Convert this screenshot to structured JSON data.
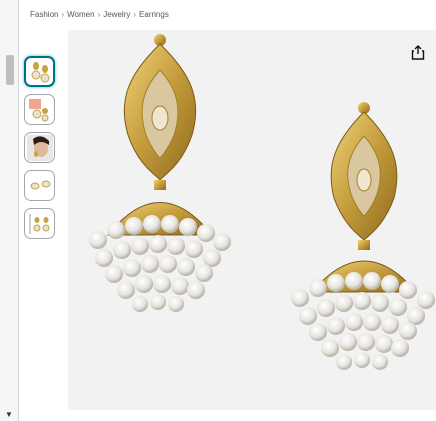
{
  "breadcrumb": [
    "Fashion",
    "Women",
    "Jewelry",
    "Earrings"
  ],
  "thumbnails": [
    {
      "name": "earrings-pair-front",
      "active": true
    },
    {
      "name": "earrings-with-box",
      "active": false
    },
    {
      "name": "earrings-model",
      "active": false
    },
    {
      "name": "earrings-flat-lay",
      "active": false
    },
    {
      "name": "earrings-dimensions",
      "active": false
    }
  ],
  "main_image": {
    "subject": "gold pearl cluster jhumka earrings"
  },
  "icons": {
    "share": "share-icon"
  }
}
